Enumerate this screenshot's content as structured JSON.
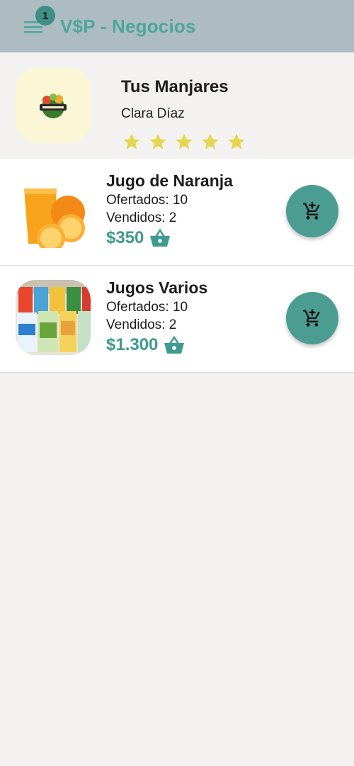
{
  "appbar": {
    "title": "V$P - Negocios",
    "notification_count": "1",
    "menu_icon": "menu-icon"
  },
  "store": {
    "name": "Tus Manjares",
    "owner": "Clara Díaz",
    "rating": 5,
    "rating_max": 5,
    "logo_text": "TUS MANJARES"
  },
  "products": [
    {
      "name": "Jugo de Naranja",
      "offered": "Ofertados: 10",
      "sold": "Vendidos: 2",
      "price": "$350"
    },
    {
      "name": "Jugos Varios",
      "offered": "Ofertados: 10",
      "sold": "Vendidos: 2",
      "price": "$1.300"
    }
  ],
  "colors": {
    "appbar": "#adbbc2",
    "accent": "#4ea69a",
    "fab": "#4b9d92",
    "star": "#e6d64f",
    "background": "#f3f2f1"
  }
}
